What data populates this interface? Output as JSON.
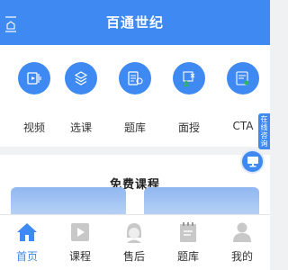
{
  "header": {
    "title": "百通世纪",
    "menu_icon": "menu-icon"
  },
  "categories": [
    {
      "label": "视频",
      "icon": "video-icon"
    },
    {
      "label": "选课",
      "icon": "stack-icon"
    },
    {
      "label": "题库",
      "icon": "document-icon"
    },
    {
      "label": "面授",
      "icon": "classroom-icon"
    },
    {
      "label": "CTA",
      "icon": "exam-icon"
    }
  ],
  "section": {
    "title": "免费课程"
  },
  "side_tab": {
    "label": "在线咨询"
  },
  "float_button": {
    "icon": "monitor-icon"
  },
  "tabbar": {
    "active_index": 0,
    "items": [
      {
        "label": "首页",
        "icon": "home-icon"
      },
      {
        "label": "课程",
        "icon": "play-icon"
      },
      {
        "label": "售后",
        "icon": "support-agent-icon"
      },
      {
        "label": "题库",
        "icon": "notepad-icon"
      },
      {
        "label": "我的",
        "icon": "person-icon"
      }
    ]
  },
  "colors": {
    "primary": "#3e8af2",
    "background": "#f0f1f3",
    "tab_inactive": "#c8c8c8"
  }
}
